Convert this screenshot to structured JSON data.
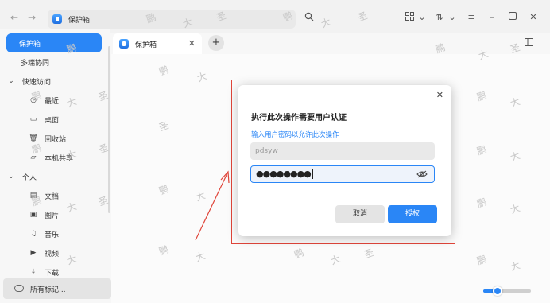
{
  "titlebar": {
    "address_label": "保护箱",
    "icons": [
      "back-icon",
      "forward-icon",
      "search-icon",
      "grid-view-icon",
      "sort-icon",
      "menu-icon",
      "minimize-icon",
      "maximize-icon",
      "close-icon"
    ]
  },
  "sidebar": {
    "items": [
      {
        "label": "保护箱",
        "icon": ""
      },
      {
        "label": "多端协同",
        "icon": ""
      },
      {
        "label": "快速访问",
        "icon": "chevron-down"
      },
      {
        "label": "最近",
        "icon": "clock"
      },
      {
        "label": "桌面",
        "icon": "monitor"
      },
      {
        "label": "回收站",
        "icon": "trash"
      },
      {
        "label": "本机共享",
        "icon": "folder"
      },
      {
        "label": "个人",
        "icon": "chevron-down"
      },
      {
        "label": "文档",
        "icon": "document"
      },
      {
        "label": "图片",
        "icon": "image"
      },
      {
        "label": "音乐",
        "icon": "music"
      },
      {
        "label": "视频",
        "icon": "video"
      },
      {
        "label": "下载",
        "icon": "download"
      }
    ],
    "tags_label": "所有标记..."
  },
  "tabs": [
    {
      "label": "保护箱"
    }
  ],
  "dialog": {
    "title": "执行此次操作需要用户认证",
    "hint": "输入用户密码以允许此次操作",
    "username": "pdsyw",
    "password_mask": "●●●●●●●●",
    "cancel_label": "取消",
    "ok_label": "授权"
  },
  "watermark": [
    "鹏",
    "大",
    "圣"
  ],
  "zoom": {
    "fraction": 0.3
  },
  "colors": {
    "accent": "#2a86f6",
    "highlight": "#e0453a"
  }
}
